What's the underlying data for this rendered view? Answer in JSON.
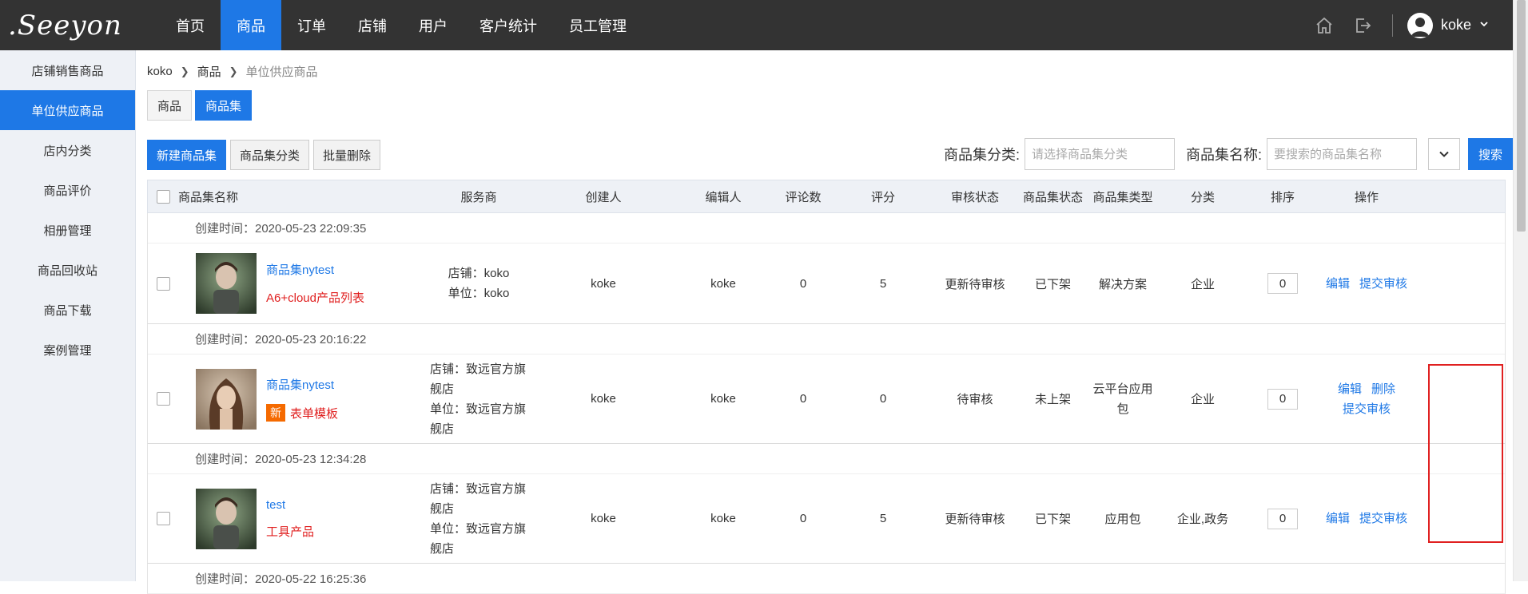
{
  "brand": {
    "logo": ".Seeyon"
  },
  "nav": [
    {
      "label": "首页"
    },
    {
      "label": "商品"
    },
    {
      "label": "订单"
    },
    {
      "label": "店铺"
    },
    {
      "label": "用户"
    },
    {
      "label": "客户统计"
    },
    {
      "label": "员工管理"
    }
  ],
  "user": {
    "name": "koke"
  },
  "sidebar": [
    {
      "label": "店铺销售商品"
    },
    {
      "label": "单位供应商品"
    },
    {
      "label": "店内分类"
    },
    {
      "label": "商品评价"
    },
    {
      "label": "相册管理"
    },
    {
      "label": "商品回收站"
    },
    {
      "label": "商品下载"
    },
    {
      "label": "案例管理"
    }
  ],
  "breadcrumb": {
    "root": "koko",
    "mid": "商品",
    "current": "单位供应商品"
  },
  "subtabs": [
    {
      "label": "商品"
    },
    {
      "label": "商品集"
    }
  ],
  "toolbar": {
    "new": "新建商品集",
    "category": "商品集分类",
    "batch_delete": "批量删除"
  },
  "filter": {
    "cat_label": "商品集分类:",
    "cat_placeholder": "请选择商品集分类",
    "name_label": "商品集名称:",
    "name_placeholder": "要搜索的商品集名称",
    "search": "搜索"
  },
  "table": {
    "headers": {
      "name": "商品集名称",
      "service": "服务商",
      "creator": "创建人",
      "editor": "编辑人",
      "comments": "评论数",
      "score": "评分",
      "audit": "审核状态",
      "state": "商品集状态",
      "type": "商品集类型",
      "category": "分类",
      "sort": "排序",
      "ops": "操作"
    },
    "rows": [
      {
        "created": "创建时间：2020-05-23 22:09:35",
        "name": "商品集nytest",
        "tag": "A6+cloud产品列表",
        "badge": "",
        "svc_line1": "店铺：koko",
        "svc_line2": "单位：koko",
        "creator": "koke",
        "editor": "koke",
        "comments": "0",
        "score": "5",
        "audit": "更新待审核",
        "state": "已下架",
        "type": "解决方案",
        "category": "企业",
        "sort": "0",
        "ops": [
          "编辑",
          "提交审核"
        ]
      },
      {
        "created": "创建时间：2020-05-23 20:16:22",
        "name": "商品集nytest",
        "tag": "表单模板",
        "badge": "新",
        "svc_line1": "店铺：致远官方旗舰店",
        "svc_line2": "单位：致远官方旗舰店",
        "creator": "koke",
        "editor": "koke",
        "comments": "0",
        "score": "0",
        "audit": "待审核",
        "state": "未上架",
        "type": "云平台应用包",
        "category": "企业",
        "sort": "0",
        "ops": [
          "编辑",
          "删除",
          "提交审核"
        ]
      },
      {
        "created": "创建时间：2020-05-23 12:34:28",
        "name": "test",
        "tag": "工具产品",
        "badge": "",
        "svc_line1": "店铺：致远官方旗舰店",
        "svc_line2": "单位：致远官方旗舰店",
        "creator": "koke",
        "editor": "koke",
        "comments": "0",
        "score": "5",
        "audit": "更新待审核",
        "state": "已下架",
        "type": "应用包",
        "category": "企业,政务",
        "sort": "0",
        "ops": [
          "编辑",
          "提交审核"
        ]
      }
    ],
    "next_created": "创建时间：2020-05-22 16:25:36"
  },
  "colors": {
    "accent": "#1e78e6",
    "topbar": "#333333",
    "highlight": "#e02020"
  }
}
